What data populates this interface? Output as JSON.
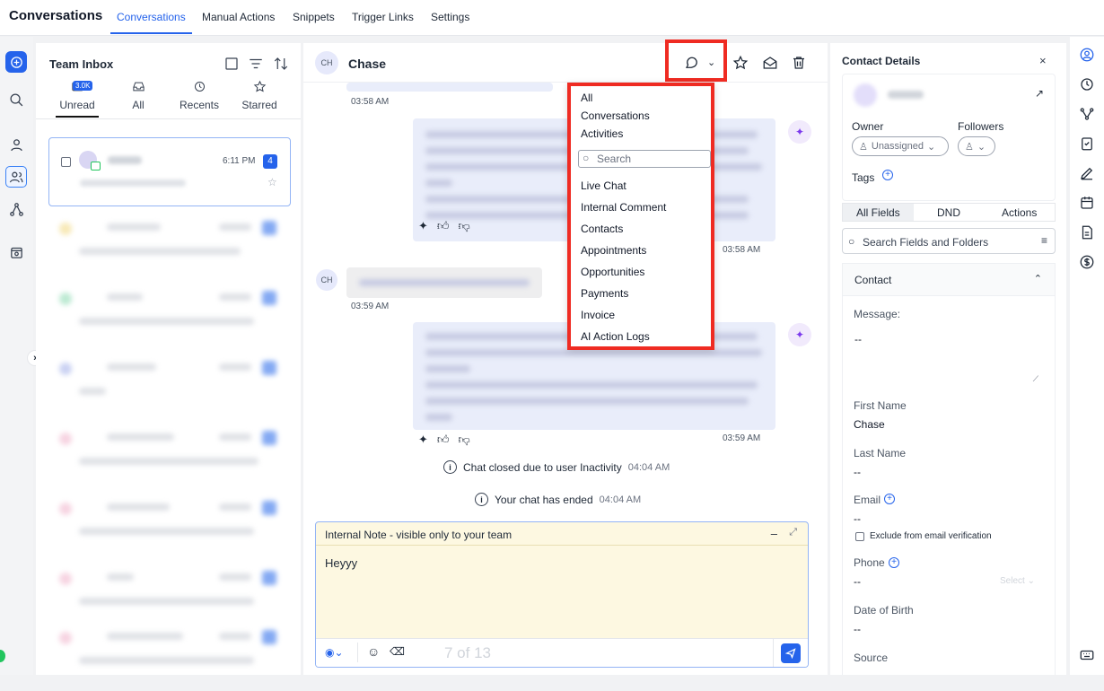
{
  "topnav": {
    "app_title": "Conversations",
    "tabs": [
      "Conversations",
      "Manual Actions",
      "Snippets",
      "Trigger Links",
      "Settings"
    ]
  },
  "inbox": {
    "title": "Team Inbox",
    "unread_badge": "3.0K",
    "tabs": [
      "Unread",
      "All",
      "Recents",
      "Starred"
    ],
    "selected_conversation": {
      "time": "6:11 PM",
      "count": "4"
    }
  },
  "chat": {
    "contact_name": "Chase",
    "avatar_initials": "CH",
    "times": [
      "03:58 AM",
      "03:58 AM",
      "03:59 AM",
      "03:59 AM"
    ],
    "system_messages": [
      {
        "text": "Chat closed due to user Inactivity",
        "time": "04:04 AM"
      },
      {
        "text": "Your chat has ended",
        "time": "04:04 AM"
      }
    ],
    "composer": {
      "header": "Internal Note - visible only to your team",
      "text": "Heyyy",
      "watermark": "7 of 13"
    }
  },
  "dropdown": {
    "items_top": [
      "All",
      "Conversations",
      "Activities"
    ],
    "search_placeholder": "Search",
    "items": [
      "Live Chat",
      "Internal Comment",
      "Contacts",
      "Appointments",
      "Opportunities",
      "Payments",
      "Invoice",
      "AI Action Logs"
    ]
  },
  "contact": {
    "title": "Contact Details",
    "owner_label": "Owner",
    "followers_label": "Followers",
    "owner_value": "Unassigned",
    "tags_label": "Tags",
    "field_tabs": [
      "All Fields",
      "DND",
      "Actions"
    ],
    "search_placeholder": "Search Fields and Folders",
    "section": "Contact",
    "message_label": "Message:",
    "message_value": "--",
    "first_name_label": "First Name",
    "first_name_value": "Chase",
    "last_name_label": "Last Name",
    "last_name_value": "--",
    "email_label": "Email",
    "email_value": "--",
    "exclude_label": "Exclude from email verification",
    "phone_label": "Phone",
    "phone_value": "--",
    "phone_select": "Select",
    "dob_label": "Date of Birth",
    "dob_value": "--",
    "source_label": "Source"
  },
  "colors": {
    "accent": "#2563eb",
    "highlight": "#ef2b22",
    "note_bg": "#fdf8e1"
  }
}
